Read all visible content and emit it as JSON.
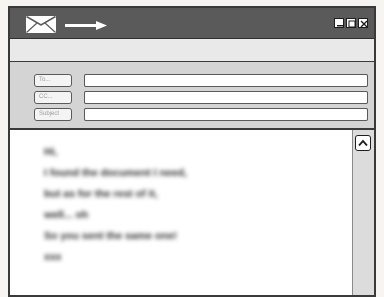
{
  "titlebar": {
    "icons": [
      "envelope-icon",
      "send-arrow-icon"
    ],
    "window_controls": [
      "minimize-icon",
      "maximize-icon",
      "close-icon"
    ]
  },
  "header": {
    "fields": [
      {
        "button_label": "To...",
        "value": ""
      },
      {
        "button_label": "CC...",
        "value": ""
      },
      {
        "button_label": "Subject",
        "value": ""
      }
    ]
  },
  "message": {
    "lines": [
      "Hi,",
      "I found the document I need,",
      "but as for the rest of it,",
      "well... oh",
      "So you sent the same one!",
      "xxx"
    ]
  },
  "colors": {
    "titlebar": "#5a5a5a",
    "header_area": "#d4d4d4",
    "scrollbar": "#dcdcdc"
  }
}
